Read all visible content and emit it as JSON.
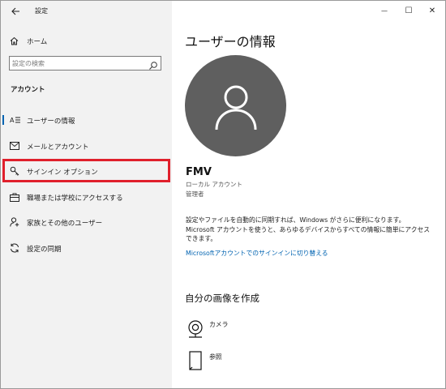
{
  "window": {
    "app_title": "設定",
    "minimize_glyph": "—",
    "maximize_glyph": "☐",
    "close_glyph": "✕"
  },
  "sidebar": {
    "home_label": "ホーム",
    "search_placeholder": "設定の検索",
    "section_title": "アカウント",
    "items": [
      {
        "label": "ユーザーの情報",
        "icon": "user-info-icon",
        "active": true
      },
      {
        "label": "メールとアカウント",
        "icon": "mail-icon",
        "active": false
      },
      {
        "label": "サインイン オプション",
        "icon": "key-icon",
        "active": false,
        "highlighted": true
      },
      {
        "label": "職場または学校にアクセスする",
        "icon": "briefcase-icon",
        "active": false
      },
      {
        "label": "家族とその他のユーザー",
        "icon": "person-add-icon",
        "active": false
      },
      {
        "label": "設定の同期",
        "icon": "sync-icon",
        "active": false
      }
    ]
  },
  "main": {
    "page_title": "ユーザーの情報",
    "user_name": "FMV",
    "account_type": "ローカル アカウント",
    "account_role": "管理者",
    "info_text": "設定やファイルを自動的に同期すれば、Windows がさらに便利になります。Microsoft アカウントを使うと、あらゆるデバイスからすべての情報に簡単にアクセスできます。",
    "switch_link": "Microsoftアカウントでのサインインに切り替える",
    "create_heading": "自分の画像を作成",
    "options": [
      {
        "label": "カメラ",
        "icon": "camera-icon"
      },
      {
        "label": "参照",
        "icon": "browse-icon"
      }
    ]
  },
  "colors": {
    "sidebar_bg": "#f2f2f2",
    "accent": "#0063b1",
    "highlight": "#e0202c",
    "avatar_bg": "#5f5f5f"
  }
}
